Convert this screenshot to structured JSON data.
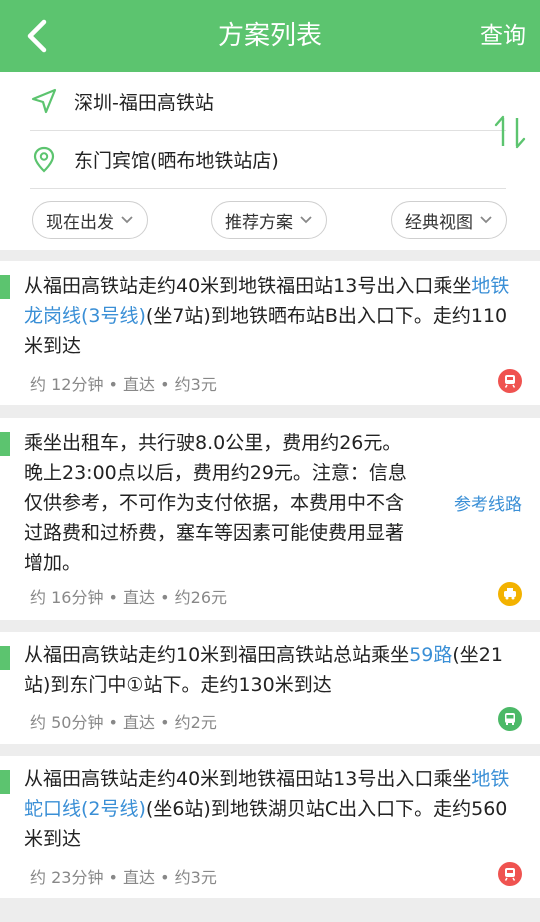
{
  "header": {
    "title": "方案列表",
    "query_label": "查询"
  },
  "form": {
    "origin": "深圳-福田高铁站",
    "destination": "东门宾馆(晒布地铁站店)",
    "filters": [
      {
        "label": "现在出发"
      },
      {
        "label": "推荐方案"
      },
      {
        "label": "经典视图"
      }
    ]
  },
  "plans": [
    {
      "desc_a": "从福田高铁站走约40米到地铁福田站13号出入口乘坐",
      "line": "地铁龙岗线(3号线)",
      "desc_b": "(坐7站)到地铁晒布站B出入口下。走约110米到达",
      "meta": "约 12分钟 • 直达 • 约3元",
      "badge_color": "#ef5350",
      "icon": "metro-icon"
    },
    {
      "desc": "乘坐出租车，共行驶8.0公里，费用约26元。晚上23:00点以后，费用约29元。注意：信息仅供参考，不可作为支付依据，本费用中不含过路费和过桥费，塞车等因素可能使费用显著增加。",
      "ref_label": "参考线路",
      "meta": "约 16分钟 • 直达 • 约26元",
      "badge_color": "#f3b200",
      "icon": "taxi-icon"
    },
    {
      "desc_a": "从福田高铁站走约10米到福田高铁站总站乘坐",
      "line": "59路",
      "desc_b": "(坐21站)到东门中①站下。走约130米到达",
      "meta": "约 50分钟 • 直达 • 约2元",
      "badge_color": "#4cb968",
      "icon": "bus-icon"
    },
    {
      "desc_a": "从福田高铁站走约40米到地铁福田站13号出入口乘坐",
      "line": "地铁蛇口线(2号线)",
      "desc_b": "(坐6站)到地铁湖贝站C出入口下。走约560米到达",
      "meta": "约 23分钟 • 直达 • 约3元",
      "badge_color": "#ef5350",
      "icon": "metro-icon"
    }
  ],
  "colors": {
    "accent": "#5cc46f",
    "link": "#3a8fd6"
  }
}
